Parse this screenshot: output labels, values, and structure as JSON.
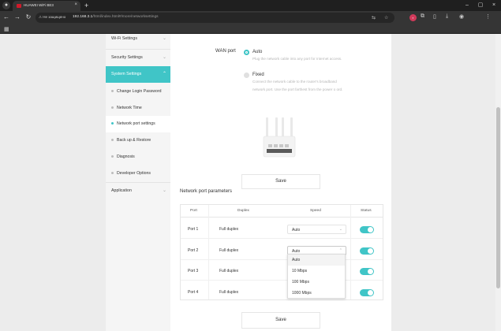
{
  "browser": {
    "tab_title": "HUAWEI WiFi BE3",
    "not_secure_label": "Не защищено",
    "url_host": "192.168.3.1",
    "url_path": "/html/index.html#/more/networksettings"
  },
  "sidebar": {
    "items": [
      {
        "label": "Wi-Fi Settings"
      },
      {
        "label": "Security Settings"
      },
      {
        "label": "System Settings"
      },
      {
        "label": "Application"
      }
    ],
    "sub_items": [
      {
        "label": "Change Login Password"
      },
      {
        "label": "Network Time"
      },
      {
        "label": "Network port settings"
      },
      {
        "label": "Back up & Restore"
      },
      {
        "label": "Diagnosis"
      },
      {
        "label": "Developer Options"
      }
    ]
  },
  "wan": {
    "label": "WAN port",
    "auto": {
      "title": "Auto",
      "desc": "Plug the network cable into any port for Internet access."
    },
    "fixed": {
      "title": "Fixed",
      "desc": "Connect the network cable to the router's broadband network port. Use the port farthest from the power o ord."
    }
  },
  "buttons": {
    "save": "Save"
  },
  "params": {
    "title": "Network port parameters",
    "headers": [
      "Port",
      "Duplex",
      "Speed",
      "Status"
    ],
    "rows": [
      {
        "port": "Port 1",
        "duplex": "Full duplex",
        "speed": "Auto",
        "status": true
      },
      {
        "port": "Port 2",
        "duplex": "Full duplex",
        "speed": "Auto",
        "status": true
      },
      {
        "port": "Port 3",
        "duplex": "Full duplex",
        "speed": "",
        "status": true
      },
      {
        "port": "Port 4",
        "duplex": "Full duplex",
        "speed": "",
        "status": true
      }
    ],
    "speed_options": [
      "Auto",
      "10 Mbps",
      "100 Mbps",
      "1000 Mbps"
    ]
  },
  "colors": {
    "accent": "#40c5c7"
  }
}
